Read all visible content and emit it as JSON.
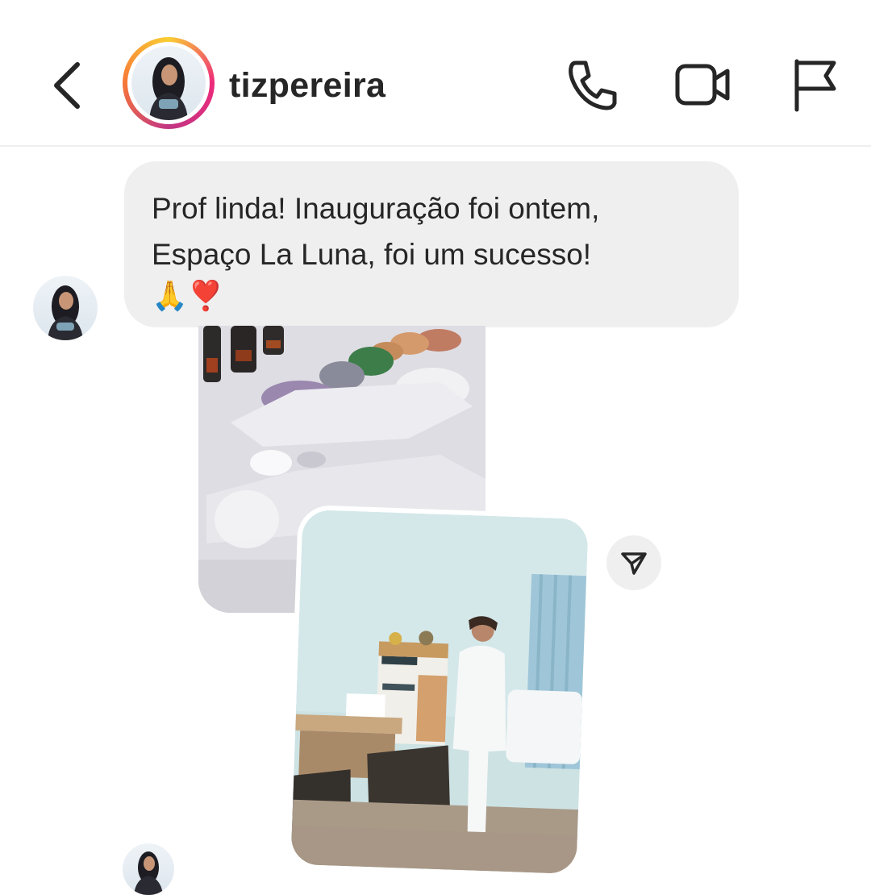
{
  "header": {
    "username": "tizpereira"
  },
  "message": {
    "line1": "Prof linda! Inauguração foi ontem,",
    "line2": "Espaço La Luna, foi um sucesso!",
    "emojis": "🙏❣️"
  },
  "icons": {
    "back": "chevron-left-icon",
    "phone": "phone-icon",
    "video": "video-camera-icon",
    "flag": "flag-icon",
    "share": "paper-plane-icon"
  },
  "colors": {
    "bubble": "#efefef",
    "text": "#262626",
    "ring_start": "#f9ce34",
    "ring_mid": "#ee2a7b",
    "ring_end": "#c13584"
  }
}
